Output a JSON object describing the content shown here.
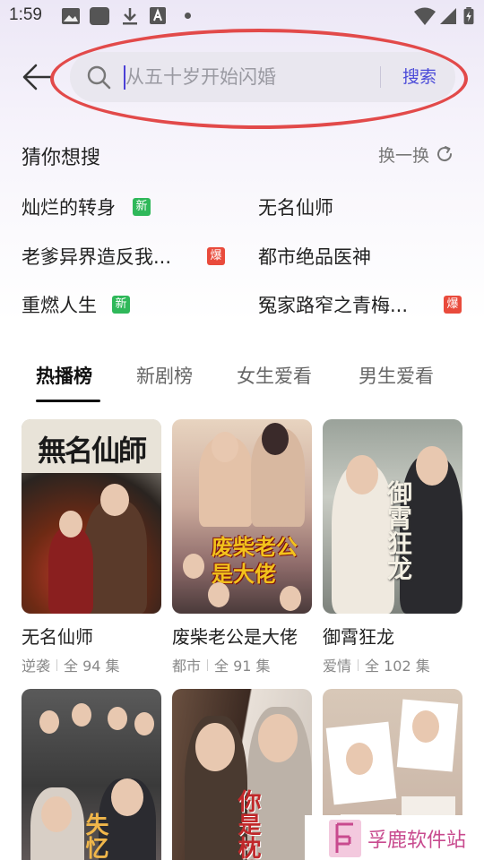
{
  "status_bar": {
    "time": "1:59"
  },
  "search": {
    "placeholder": "从五十岁开始闪婚",
    "button_label": "搜索"
  },
  "guess": {
    "title": "猜你想搜",
    "refresh_label": "换一换",
    "items": [
      {
        "title": "灿烂的转身",
        "badge": "新",
        "badge_type": "new"
      },
      {
        "title": "无名仙师",
        "badge": "",
        "badge_type": ""
      },
      {
        "title": "老爹异界造反我...",
        "badge": "爆",
        "badge_type": "hot"
      },
      {
        "title": "都市绝品医神",
        "badge": "",
        "badge_type": ""
      },
      {
        "title": "重燃人生",
        "badge": "新",
        "badge_type": "new"
      },
      {
        "title": "冤家路窄之青梅...",
        "badge": "爆",
        "badge_type": "hot"
      }
    ]
  },
  "tabs": [
    {
      "label": "热播榜",
      "active": true
    },
    {
      "label": "新剧榜",
      "active": false
    },
    {
      "label": "女生爱看",
      "active": false
    },
    {
      "label": "男生爱看",
      "active": false
    }
  ],
  "cards": [
    {
      "title": "无名仙师",
      "genre": "逆袭",
      "episodes": "全 94 集",
      "poster_text": "無名仙師"
    },
    {
      "title": "废柴老公是大佬",
      "genre": "都市",
      "episodes": "全 91 集",
      "poster_text": "废柴老公是大佬"
    },
    {
      "title": "御霄狂龙",
      "genre": "爱情",
      "episodes": "全 102 集",
      "poster_text": "御霄狂龙"
    },
    {
      "title": "",
      "genre": "",
      "episodes": "",
      "poster_text": "失忆"
    },
    {
      "title": "",
      "genre": "",
      "episodes": "",
      "poster_text": "你是枕边"
    },
    {
      "title": "",
      "genre": "",
      "episodes": "",
      "poster_text": ""
    }
  ],
  "watermark": {
    "text": "孚鹿软件站"
  },
  "colors": {
    "accent": "#4b4bd8",
    "badge_new": "#2fb85a",
    "badge_hot": "#e94b3c",
    "annotation_circle": "#e24a4a"
  }
}
